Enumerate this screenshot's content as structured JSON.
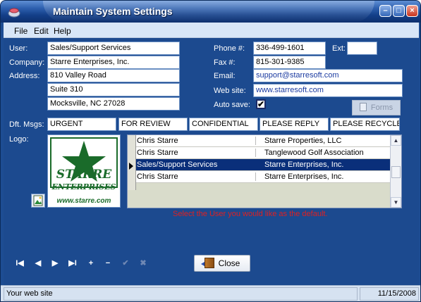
{
  "window": {
    "title": "Maintain System Settings"
  },
  "menu": {
    "file": "File",
    "edit": "Edit",
    "help": "Help"
  },
  "form": {
    "user_label": "User:",
    "user_value": "Sales/Support Services",
    "company_label": "Company:",
    "company_value": "Starre Enterprises, Inc.",
    "address_label": "Address:",
    "address_line1": "810 Valley Road",
    "address_line2": "Suite 310",
    "address_line3": "Mocksville, NC  27028",
    "phone_label": "Phone #:",
    "phone_value": "336-499-1601",
    "ext_label": "Ext:",
    "ext_value": "",
    "fax_label": "Fax #:",
    "fax_value": "815-301-9385",
    "email_label": "Email:",
    "email_value": "support@starresoft.com",
    "website_label": "Web site:",
    "website_value": "www.starresoft.com",
    "autosave_label": "Auto save:",
    "autosave_checked": "✔",
    "forms_button": "Forms",
    "dft_msgs_label": "Dft. Msgs:",
    "messages": [
      "URGENT",
      "FOR REVIEW",
      "CONFIDENTIAL",
      "PLEASE REPLY",
      "PLEASE RECYCLE"
    ],
    "logo_label": "Logo:"
  },
  "logo": {
    "line1": "STARRE",
    "line2": "ENTERPRISES",
    "url": "www.starre.com"
  },
  "users_grid": {
    "rows": [
      {
        "name": "Chris Starre",
        "company": "Starre Properties, LLC",
        "selected": false
      },
      {
        "name": "Chris Starre",
        "company": "Tanglewood Golf Association",
        "selected": false
      },
      {
        "name": "Sales/Support Services",
        "company": "Starre Enterprises, Inc.",
        "selected": true
      },
      {
        "name": "Chris Starre",
        "company": "Starre Enterprises, Inc.",
        "selected": false
      }
    ]
  },
  "hint": "Select the User you would like as the default.",
  "nav": {
    "first": "I◀",
    "prev": "◀",
    "next": "▶",
    "last": "▶I",
    "add": "+",
    "delete": "−",
    "post": "✔",
    "cancel": "✖"
  },
  "close_button": "Close",
  "status": {
    "message": "Your web site",
    "date": "11/15/2008"
  },
  "colors": {
    "client_bg": "#1c4a8f",
    "selected_row": "#0a2f7a",
    "hint": "#e02020"
  }
}
